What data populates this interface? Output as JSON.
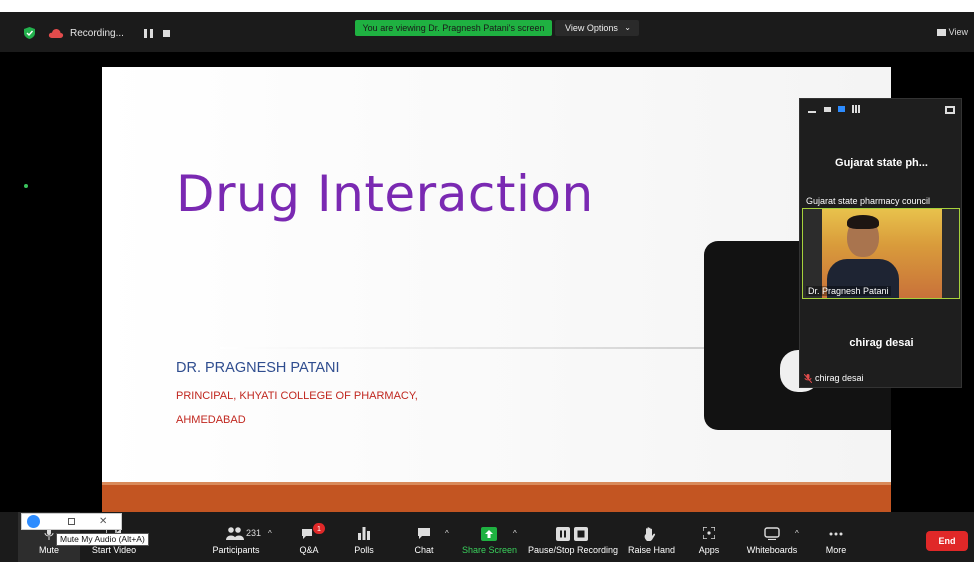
{
  "top_bar": {
    "recording_label": "Recording...",
    "viewing_banner": "You are viewing Dr. Pragnesh Patani's screen",
    "view_options_label": "View Options",
    "view_label": "View"
  },
  "slide": {
    "title": "Drug Interaction",
    "author": "DR. PRAGNESH PATANI",
    "line1": "PRINCIPAL, KHYATI COLLEGE OF PHARMACY,",
    "line2": "AHMEDABAD"
  },
  "participants_panel": {
    "tile1_name_large": "Gujarat state ph...",
    "tile1_name_small": "Gujarat state pharmacy council",
    "video_name": "Dr. Pragnesh Patani",
    "tile3_name_large": "chirag desai",
    "tile3_name_small": "chirag desai"
  },
  "toolbar": {
    "mute": "Mute",
    "start_video": "Start Video",
    "participants": "Participants",
    "participants_count": "231",
    "qa": "Q&A",
    "qa_badge": "1",
    "polls": "Polls",
    "chat": "Chat",
    "share_screen": "Share Screen",
    "pause_stop_recording": "Pause/Stop Recording",
    "raise_hand": "Raise Hand",
    "apps": "Apps",
    "whiteboards": "Whiteboards",
    "more": "More",
    "end": "End"
  },
  "tooltip": "Mute My Audio (Alt+A)",
  "colors": {
    "zoom_blue": "#2d8cff",
    "share_green": "#1fb141",
    "end_red": "#e02828",
    "title_purple": "#7a29b2",
    "author_blue": "#2f4d8f",
    "subtitle_red": "#c0271f"
  }
}
